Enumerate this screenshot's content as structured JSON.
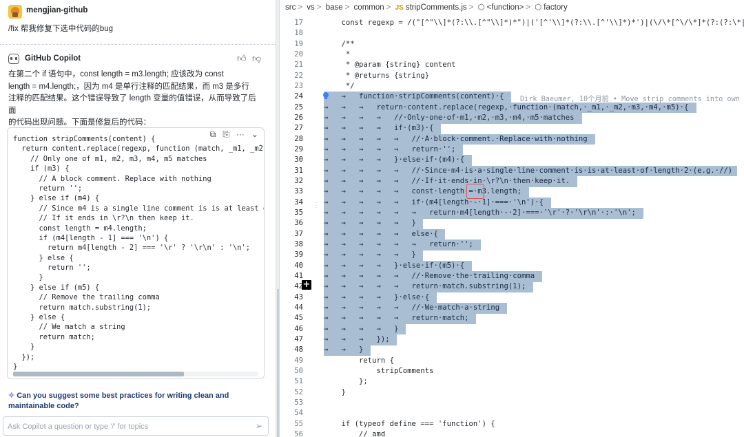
{
  "chat": {
    "user": {
      "name": "mengjian-github",
      "message": "/fix 帮我修复下选中代码的bug"
    },
    "copilot": {
      "name": "GitHub Copilot",
      "thumbs_up_icon": "thumbs-up-icon",
      "thumbs_down_icon": "thumbs-down-icon",
      "answer_lines": [
        "在第二个 if 语句中，const length = m3.length; 应该改为 const",
        "length = m4.length;，因为 m4 是单行注释的匹配结果，而 m3 是多行",
        "注释的匹配结果。这个错误导致了 length 变量的值错误，从而导致了后面",
        "的代码出现问题。下面是修复后的代码："
      ],
      "code_tools": [
        "⧉",
        "⎘",
        "···",
        "⌄"
      ],
      "code_lines": [
        "function stripComments(content) {",
        "  return content.replace(regexp, function (match, _m1, _m2,",
        "    // Only one of m1, m2, m3, m4, m5 matches",
        "    if (m3) {",
        "      // A block comment. Replace with nothing",
        "      return '';",
        "    } else if (m4) {",
        "      // Since m4 is a single line comment is is at least of",
        "      // If it ends in \\r?\\n then keep it.",
        "      const length = m4.length;",
        "      if (m4[length - 1] === '\\n') {",
        "        return m4[length - 2] === '\\r' ? '\\r\\n' : '\\n';",
        "      } else {",
        "        return '';",
        "      }",
        "    } else if (m5) {",
        "      // Remove the trailing comma",
        "      return match.substring(1);",
        "    } else {",
        "      // We match a string",
        "      return match;",
        "    }",
        "  });",
        "}"
      ]
    },
    "suggestion": "Can you suggest some best practices for writing clean and maintainable code?",
    "input": {
      "placeholder": "Ask Copilot a question or type '/' for topics",
      "value": ""
    }
  },
  "editor": {
    "breadcrumb": [
      "src",
      "vs",
      "base",
      "common",
      "stripComments.js",
      "<function>",
      "factory"
    ],
    "blame": "Dirk Baeumer, 10个月前 • Move strip comments into own",
    "lines": [
      {
        "n": 17,
        "text": "    const regexp = /(\"[^\"\\\\]*(?:\\\\.[^\"\\\\]*)*\")|('[^'\\\\]*(?:\\\\.[^'\\\\]*)*')|(\\/\\*[^\\/\\*]*(?:(?:\\*|",
        "sel": false
      },
      {
        "n": 18,
        "text": "",
        "sel": false
      },
      {
        "n": 19,
        "text": "    /**",
        "sel": false
      },
      {
        "n": 20,
        "text": "     *",
        "sel": false
      },
      {
        "n": 21,
        "text": "     * @param {string} content",
        "sel": false
      },
      {
        "n": 22,
        "text": "     * @returns {string}",
        "sel": false
      },
      {
        "n": 23,
        "text": "     */",
        "sel": false
      },
      {
        "n": 24,
        "text": "→   →   function·stripComments(content)·{",
        "sel": true
      },
      {
        "n": 25,
        "text": "→   →   →   return·content.replace(regexp,·function·(match,·_m1,·_m2,·m3,·m4,·m5)·{",
        "sel": true
      },
      {
        "n": 26,
        "text": "→   →   →   →   //·Only·one·of·m1,·m2,·m3,·m4,·m5·matches",
        "sel": true
      },
      {
        "n": 27,
        "text": "→   →   →   →   if·(m3)·{",
        "sel": true
      },
      {
        "n": 28,
        "text": "→   →   →   →   →   //·A·block·comment.·Replace·with·nothing",
        "sel": true
      },
      {
        "n": 29,
        "text": "→   →   →   →   →   return·'';",
        "sel": true
      },
      {
        "n": 30,
        "text": "→   →   →   →   }·else·if·(m4)·{",
        "sel": true
      },
      {
        "n": 31,
        "text": "→   →   →   →   →   //·Since·m4·is·a·single·line·comment·is·is·at·least·of·length·2·(e.g.·//)",
        "sel": true
      },
      {
        "n": 32,
        "text": "→   →   →   →   →   //·If·it·ends·in·\\r?\\n·then·keep·it.",
        "sel": true
      },
      {
        "n": 33,
        "text": "→   →   →   →   →   const·length·=·m3.length;",
        "sel": true
      },
      {
        "n": 34,
        "text": "→   →   →   →   →   if·(m4[length·-·1]·===·'\\n')·{",
        "sel": true
      },
      {
        "n": 35,
        "text": "→   →   →   →   →   →   return·m4[length·-·2]·===·'\\r'·?·'\\r\\n'·:·'\\n';",
        "sel": true
      },
      {
        "n": 36,
        "text": "→   →   →   →   →   }",
        "sel": true
      },
      {
        "n": 37,
        "text": "→   →   →   →   →   else·{",
        "sel": true
      },
      {
        "n": 38,
        "text": "→   →   →   →   →   →   return·'';",
        "sel": true
      },
      {
        "n": 39,
        "text": "→   →   →   →   →   }",
        "sel": true
      },
      {
        "n": 40,
        "text": "→   →   →   →   }·else·if·(m5)·{",
        "sel": true
      },
      {
        "n": 41,
        "text": "→   →   →   →   →   //·Remove·the·trailing·comma",
        "sel": true
      },
      {
        "n": 42,
        "text": "→   →   →   →   →   return·match.substring(1);",
        "sel": true
      },
      {
        "n": 43,
        "text": "→   →   →   →   }·else·{",
        "sel": true
      },
      {
        "n": 44,
        "text": "→   →   →   →   →   //·We·match·a·string",
        "sel": true
      },
      {
        "n": 45,
        "text": "→   →   →   →   →   return·match;",
        "sel": true
      },
      {
        "n": 46,
        "text": "→   →   →   →   }",
        "sel": true
      },
      {
        "n": 47,
        "text": "→   →   →   });",
        "sel": true
      },
      {
        "n": 48,
        "text": "→   →   }",
        "sel": true
      },
      {
        "n": 49,
        "text": "        return {",
        "sel": false
      },
      {
        "n": 50,
        "text": "            stripComments",
        "sel": false
      },
      {
        "n": 51,
        "text": "        };",
        "sel": false
      },
      {
        "n": 52,
        "text": "    }",
        "sel": false
      },
      {
        "n": 53,
        "text": "",
        "sel": false
      },
      {
        "n": 54,
        "text": "",
        "sel": false
      },
      {
        "n": 55,
        "text": "    if (typeof define === 'function') {",
        "sel": false
      },
      {
        "n": 56,
        "text": "        // amd",
        "sel": false
      }
    ]
  },
  "colors": {
    "selection": "#a9bdd3",
    "highlight_box": "#d9534f",
    "accent": "#6a60d8"
  }
}
